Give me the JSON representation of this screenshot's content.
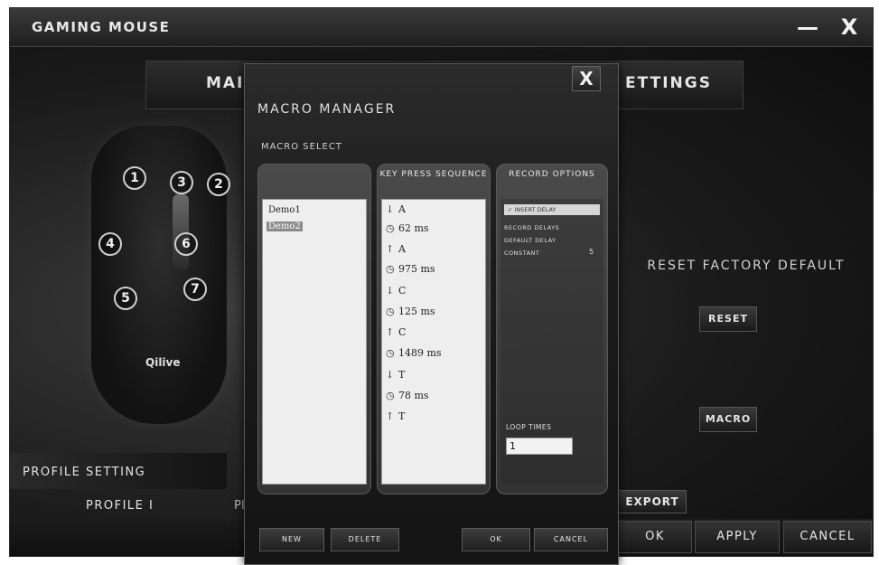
{
  "window": {
    "title": "GAMING MOUSE",
    "minimize": "—",
    "close": "X"
  },
  "tabs": {
    "main_partial": "MAI",
    "settings_partial": "ETTINGS"
  },
  "mouse": {
    "buttons": [
      "1",
      "2",
      "3",
      "4",
      "5",
      "6",
      "7"
    ],
    "logo": "Qilive"
  },
  "profile": {
    "section_label": "PROFILE SETTING",
    "tab1": "PROFILE I",
    "tab2_partial": "PI"
  },
  "right_panel": {
    "reset_text": "RESET FACTORY DEFAULT",
    "reset_button": "RESET",
    "macro_button": "MACRO",
    "export_button_partial": "EXPORT"
  },
  "footer": {
    "ok": "OK",
    "apply": "APPLY",
    "cancel": "CANCEL"
  },
  "dialog": {
    "close": "X",
    "title": "MACRO MANAGER",
    "subtitle": "MACRO SELECT",
    "columns": {
      "macro_list_header": "",
      "sequence_header": "KEY PRESS SEQUENCE",
      "record_header": "RECORD OPTIONS"
    },
    "macros": [
      {
        "name": "Demo1",
        "selected": false
      },
      {
        "name": "Demo2",
        "selected": true
      }
    ],
    "sequence": [
      {
        "icon": "↓",
        "text": "A"
      },
      {
        "icon": "◷",
        "text": "62 ms"
      },
      {
        "icon": "↑",
        "text": "A"
      },
      {
        "icon": "◷",
        "text": "975 ms"
      },
      {
        "icon": "↓",
        "text": "C"
      },
      {
        "icon": "◷",
        "text": "125 ms"
      },
      {
        "icon": "↑",
        "text": "C"
      },
      {
        "icon": "◷",
        "text": "1489 ms"
      },
      {
        "icon": "↓",
        "text": "T"
      },
      {
        "icon": "◷",
        "text": "78 ms"
      },
      {
        "icon": "↑",
        "text": "T"
      }
    ],
    "record_options": {
      "check_label": "✓ INSERT DELAY",
      "opt1": "RECORD DELAYS",
      "opt2": "DEFAULT DELAY",
      "opt3": "CONSTANT",
      "opt3_value": "5",
      "loop_label": "LOOP TIMES",
      "loop_value": "1"
    },
    "buttons": {
      "new": "NEW",
      "delete": "DELETE",
      "ok": "OK",
      "cancel": "CANCEL"
    }
  }
}
